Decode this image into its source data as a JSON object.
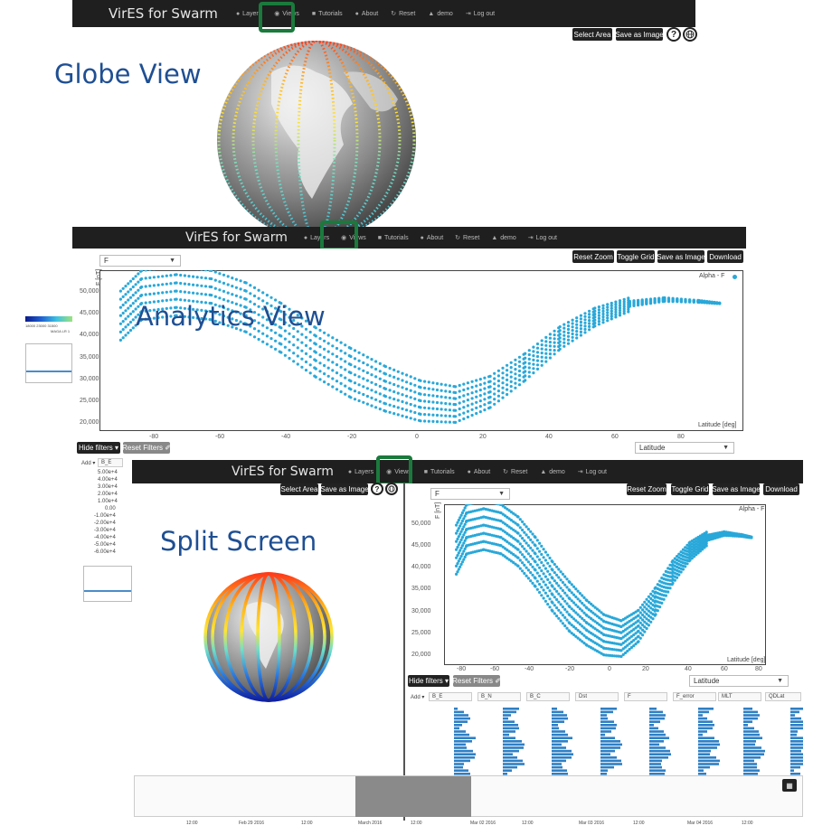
{
  "navbar": {
    "brand": "VirES for Swarm",
    "items": [
      {
        "label": "Layers",
        "icon": "globe-icon",
        "glyph": "●"
      },
      {
        "label": "Views",
        "icon": "eye-icon",
        "glyph": "◉"
      },
      {
        "label": "Tutorials",
        "icon": "book-icon",
        "glyph": "■"
      },
      {
        "label": "About",
        "icon": "info-icon",
        "glyph": "●"
      },
      {
        "label": "Reset",
        "icon": "refresh-icon",
        "glyph": "↻"
      },
      {
        "label": "demo",
        "icon": "user-icon",
        "glyph": "▲"
      },
      {
        "label": "Log out",
        "icon": "logout-icon",
        "glyph": "⇥"
      }
    ]
  },
  "globe_toolbar": {
    "select_area": "Select Area",
    "save_image": "Save as Image",
    "help": "?"
  },
  "analytics_toolbar": {
    "reset_zoom": "Reset Zoom",
    "toggle_grid": "Toggle Grid",
    "save_image": "Save as Image",
    "download": "Download"
  },
  "labels": {
    "globe": "Globe View",
    "analytics": "Analytics View",
    "split": "Split Screen"
  },
  "plot": {
    "y_param": "F",
    "x_param": "Latitude",
    "ylabel": "F [nT]",
    "xlabel": "Latitude [deg]",
    "legend": "Alpha - F",
    "yticks": [
      "50,000",
      "45,000",
      "40,000",
      "35,000",
      "30,000",
      "25,000",
      "20,000"
    ],
    "xticks": [
      "-80",
      "-60",
      "-40",
      "-20",
      "0",
      "20",
      "40",
      "60",
      "80"
    ]
  },
  "filters": {
    "hide": "Hide filters ▾",
    "reset": "Reset Filters ✐",
    "add": "Add ▾",
    "columns": [
      "B_E",
      "B_N",
      "B_C",
      "Dst",
      "F",
      "F_error",
      "MLT",
      "QDLat"
    ]
  },
  "colorbar": {
    "ticks": "18000   23000   31500   38000   47000   55000",
    "label": "MAGA LR 1B - F [nT]"
  },
  "colorbar_left": {
    "ticks": "18000   23000   31500",
    "label": "MAGA LR 1"
  },
  "hist_left_values": [
    "5.00e+4",
    "4.00e+4",
    "3.00e+4",
    "2.00e+4",
    "1.00e+4",
    "0.00",
    "-1.00e+4",
    "-2.00e+4",
    "-3.00e+4",
    "-4.00e+4",
    "-5.00e+4",
    "-6.00e+4"
  ],
  "timeline": {
    "labels": [
      "12:00",
      "Feb 29 2016",
      "12:00",
      "March 2016",
      "12:00",
      "Mar 02 2016",
      "12:00",
      "Mar 03 2016",
      "12:00",
      "Mar 04 2016",
      "12:00"
    ]
  },
  "chart_data": {
    "type": "scatter",
    "xlabel": "Latitude [deg]",
    "ylabel": "F [nT]",
    "xlim": [
      -90,
      90
    ],
    "ylim": [
      18000,
      52000
    ],
    "series": [
      {
        "name": "Alpha - F",
        "color": "#29a8d9",
        "x": [
          -86,
          -80,
          -70,
          -60,
          -50,
          -40,
          -30,
          -20,
          -10,
          0,
          10,
          20,
          30,
          40,
          50,
          60,
          70,
          80,
          86
        ],
        "y": [
          45000,
          50000,
          51000,
          50000,
          47000,
          42000,
          36000,
          31000,
          27000,
          24000,
          23000,
          26000,
          32000,
          39000,
          44000,
          47000,
          48000,
          47500,
          47000
        ]
      }
    ]
  }
}
